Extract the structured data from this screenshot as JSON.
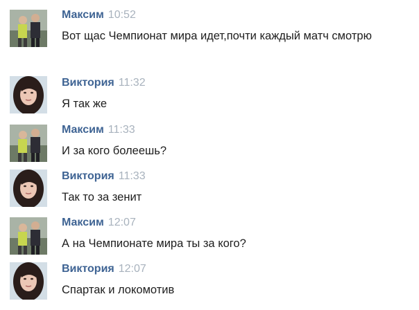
{
  "messages": [
    {
      "author": "Максим",
      "time": "10:52",
      "text": "Вот щас Чемпионат мира идет,почти каждый матч смотрю"
    },
    {
      "author": "Виктория",
      "time": "11:32",
      "text": "Я так же"
    },
    {
      "author": "Максим",
      "time": "11:33",
      "text": "И за кого болеешь?"
    },
    {
      "author": "Виктория",
      "time": "11:33",
      "text": "Так то за зенит"
    },
    {
      "author": "Максим",
      "time": "12:07",
      "text": "А на Чемпионате мира ты за кого?"
    },
    {
      "author": "Виктория",
      "time": "12:07",
      "text": "Спартак и локомотив"
    }
  ],
  "colors": {
    "author": "#3e6393",
    "time": "#a8b2bd",
    "text": "#1d1d1d",
    "background": "#ffffff"
  },
  "icons": {
    "maxim_avatar": "photo-two-people-avatar-icon",
    "viktoria_avatar": "photo-girl-avatar-icon"
  }
}
